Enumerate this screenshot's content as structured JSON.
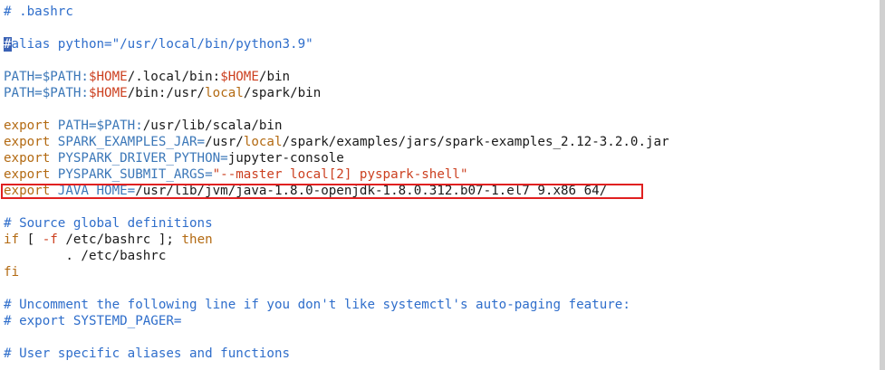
{
  "editor": {
    "lines": [
      {
        "segments": [
          {
            "t": "# .bashrc",
            "c": "comment"
          }
        ]
      },
      {
        "segments": []
      },
      {
        "segments": [
          {
            "t": "#",
            "c": "cursor"
          },
          {
            "t": "alias python=\"/usr/local/bin/python3.9\"",
            "c": "comment"
          }
        ]
      },
      {
        "segments": []
      },
      {
        "segments": [
          {
            "t": "PATH=$PATH:",
            "c": "var"
          },
          {
            "t": "$HOME",
            "c": "str"
          },
          {
            "t": "/.local/bin:",
            "c": "plain"
          },
          {
            "t": "$HOME",
            "c": "str"
          },
          {
            "t": "/bin",
            "c": "plain"
          }
        ]
      },
      {
        "segments": [
          {
            "t": "PATH=$PATH:",
            "c": "var"
          },
          {
            "t": "$HOME",
            "c": "str"
          },
          {
            "t": "/bin:/usr/",
            "c": "plain"
          },
          {
            "t": "local",
            "c": "keyword"
          },
          {
            "t": "/spark/bin",
            "c": "plain"
          }
        ]
      },
      {
        "segments": []
      },
      {
        "segments": [
          {
            "t": "export ",
            "c": "keyword"
          },
          {
            "t": "PATH=$PATH:",
            "c": "var"
          },
          {
            "t": "/usr/lib/scala/bin",
            "c": "plain"
          }
        ]
      },
      {
        "segments": [
          {
            "t": "export ",
            "c": "keyword"
          },
          {
            "t": "SPARK_EXAMPLES_JAR=",
            "c": "var"
          },
          {
            "t": "/usr/",
            "c": "plain"
          },
          {
            "t": "local",
            "c": "keyword"
          },
          {
            "t": "/spark/examples/jars/spark-examples_2.12-3.2.0.jar",
            "c": "plain"
          }
        ]
      },
      {
        "segments": [
          {
            "t": "export ",
            "c": "keyword"
          },
          {
            "t": "PYSPARK_DRIVER_PYTHON=",
            "c": "var"
          },
          {
            "t": "jupyter-console",
            "c": "plain"
          }
        ]
      },
      {
        "segments": [
          {
            "t": "export ",
            "c": "keyword"
          },
          {
            "t": "PYSPARK_SUBMIT_ARGS=",
            "c": "var"
          },
          {
            "t": "\"--master local[2] pyspark-shell\"",
            "c": "str"
          }
        ]
      },
      {
        "segments": [
          {
            "t": "export ",
            "c": "keyword"
          },
          {
            "t": "JAVA_HOME=",
            "c": "var"
          },
          {
            "t": "/usr/lib/jvm/java-1.8.0-openjdk-1.8.0.312.b07-1.el7_9.x86_64/",
            "c": "plain"
          }
        ]
      },
      {
        "segments": []
      },
      {
        "segments": [
          {
            "t": "# Source global definitions",
            "c": "comment"
          }
        ]
      },
      {
        "segments": [
          {
            "t": "if",
            "c": "keyword"
          },
          {
            "t": " [ ",
            "c": "plain"
          },
          {
            "t": "-f",
            "c": "str"
          },
          {
            "t": " /etc/bashrc ]; ",
            "c": "plain"
          },
          {
            "t": "then",
            "c": "keyword"
          }
        ]
      },
      {
        "segments": [
          {
            "t": "        . /etc/bashrc",
            "c": "plain"
          }
        ]
      },
      {
        "segments": [
          {
            "t": "fi",
            "c": "keyword"
          }
        ]
      },
      {
        "segments": []
      },
      {
        "segments": [
          {
            "t": "# Uncomment the following line if you don't like systemctl's auto-paging feature:",
            "c": "comment"
          }
        ]
      },
      {
        "segments": [
          {
            "t": "# export SYSTEMD_PAGER=",
            "c": "comment"
          }
        ]
      },
      {
        "segments": []
      },
      {
        "segments": [
          {
            "t": "# User specific aliases and functions",
            "c": "comment"
          }
        ]
      }
    ]
  },
  "colors": {
    "comment": "#2f6ecb",
    "keyword": "#b36a12",
    "var": "#3b77b8",
    "str": "#cc4020",
    "highlight_border": "#e02020",
    "cursor": "#3a62b5"
  }
}
